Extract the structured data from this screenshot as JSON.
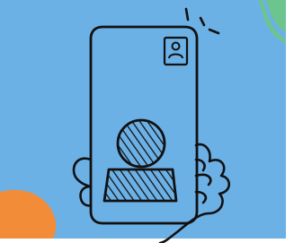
{
  "illustration": {
    "subject": "phone-video-call-icon",
    "colors": {
      "background": "#6cb1e6",
      "outline": "#111111",
      "accent_orange": "#f28c38",
      "accent_green": "#6cc48f",
      "page_margin": "#ffffff"
    }
  }
}
